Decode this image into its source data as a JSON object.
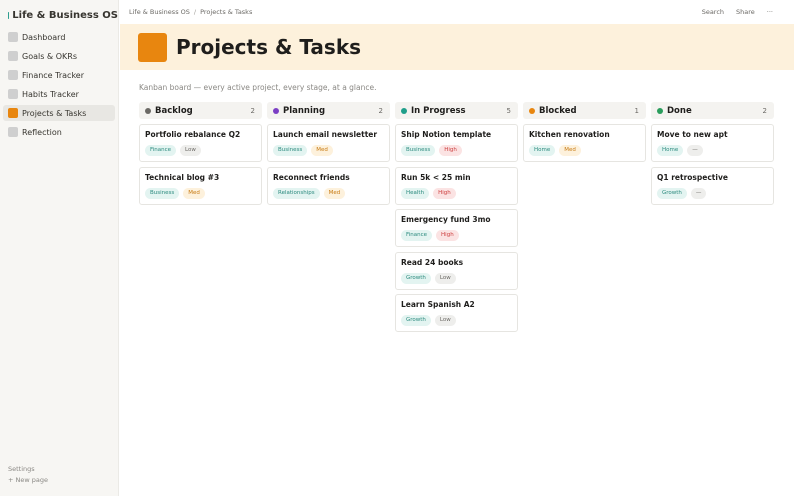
{
  "sidebar": {
    "workspace": "Life & Business OS",
    "items": [
      {
        "label": "Dashboard",
        "active": false
      },
      {
        "label": "Goals & OKRs",
        "active": false
      },
      {
        "label": "Finance Tracker",
        "active": false
      },
      {
        "label": "Habits Tracker",
        "active": false
      },
      {
        "label": "Projects & Tasks",
        "active": true
      },
      {
        "label": "Reflection",
        "active": false
      }
    ],
    "footer": {
      "settings": "Settings",
      "new_page": "+  New page"
    }
  },
  "topbar": {
    "breadcrumb": [
      "Life & Business OS",
      "/",
      "Projects & Tasks"
    ],
    "search": "Search",
    "share": "Share",
    "more": "···"
  },
  "page": {
    "title": "Projects & Tasks",
    "subtitle": "Kanban board — every active project, every stage, at a glance."
  },
  "colors": {
    "accent": "#e8860f",
    "backlog": "#6b6965",
    "planning": "#7b3fc4",
    "in_progress": "#1f9e8a",
    "blocked": "#e8860f",
    "done": "#2a9d5c"
  },
  "board": {
    "columns": [
      {
        "title": "Backlog",
        "count": "2",
        "cards": [
          {
            "title": "Portfolio rebalance Q2",
            "area": "Finance",
            "priority": "Low"
          },
          {
            "title": "Technical blog #3",
            "area": "Business",
            "priority": "Med"
          }
        ]
      },
      {
        "title": "Planning",
        "count": "2",
        "cards": [
          {
            "title": "Launch email newsletter",
            "area": "Business",
            "priority": "Med"
          },
          {
            "title": "Reconnect friends",
            "area": "Relationships",
            "priority": "Med"
          }
        ]
      },
      {
        "title": "In Progress",
        "count": "5",
        "cards": [
          {
            "title": "Ship Notion template",
            "area": "Business",
            "priority": "High"
          },
          {
            "title": "Run 5k < 25 min",
            "area": "Health",
            "priority": "High"
          },
          {
            "title": "Emergency fund 3mo",
            "area": "Finance",
            "priority": "High"
          },
          {
            "title": "Read 24 books",
            "area": "Growth",
            "priority": "Low"
          },
          {
            "title": "Learn Spanish A2",
            "area": "Growth",
            "priority": "Low"
          }
        ]
      },
      {
        "title": "Blocked",
        "count": "1",
        "cards": [
          {
            "title": "Kitchen renovation",
            "area": "Home",
            "priority": "Med"
          }
        ]
      },
      {
        "title": "Done",
        "count": "2",
        "cards": [
          {
            "title": "Move to new apt",
            "area": "Home",
            "priority": "—"
          },
          {
            "title": "Q1 retrospective",
            "area": "Growth",
            "priority": "—"
          }
        ]
      }
    ]
  }
}
